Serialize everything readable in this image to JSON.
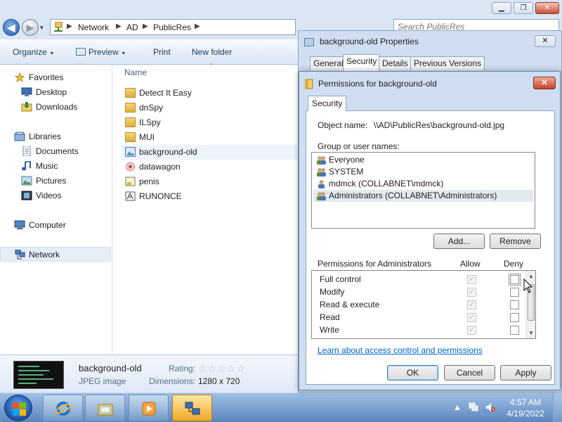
{
  "explorer": {
    "controls": {
      "minimize": "▁",
      "maximize": "❐",
      "close": "✕"
    },
    "nav": {
      "back": "◀",
      "forward": "▶",
      "dropdown": "▾"
    },
    "address": {
      "segments": [
        "Network",
        "AD",
        "PublicRes"
      ],
      "separator": "▶"
    },
    "search": {
      "placeholder": "Search PublicRes"
    },
    "toolbar": {
      "organize": "Organize",
      "preview": "Preview",
      "print": "Print",
      "new_folder": "New folder",
      "caret": "▾"
    },
    "navpane": {
      "favorites": "Favorites",
      "favorites_items": [
        "Desktop",
        "Downloads"
      ],
      "libraries": "Libraries",
      "libraries_items": [
        "Documents",
        "Music",
        "Pictures",
        "Videos"
      ],
      "computer": "Computer",
      "network": "Network"
    },
    "column_header": "Name",
    "files": [
      {
        "name": "Detect It Easy",
        "type": "folder"
      },
      {
        "name": "dnSpy",
        "type": "folder"
      },
      {
        "name": "ILSpy",
        "type": "folder"
      },
      {
        "name": "MUI",
        "type": "folder"
      },
      {
        "name": "background-old",
        "type": "image",
        "selected": true
      },
      {
        "name": "datawagon",
        "type": "app"
      },
      {
        "name": "penis",
        "type": "script"
      },
      {
        "name": "RUNONCE",
        "type": "app"
      }
    ],
    "details": {
      "file_name": "background-old",
      "file_type": "JPEG image",
      "rating_label": "Rating:",
      "stars": "☆☆☆☆☆",
      "dimensions_label": "Dimensions:",
      "dimensions_value": "1280 x 720"
    }
  },
  "properties": {
    "title": "background-old Properties",
    "close": "✕",
    "tabs": [
      "General",
      "Security",
      "Details",
      "Previous Versions"
    ],
    "active_tab": "Security"
  },
  "permissions": {
    "title": "Permissions for background-old",
    "close": "✕",
    "tab": "Security",
    "object_label": "Object name:",
    "object_value": "\\\\AD\\PublicRes\\background-old.jpg",
    "group_label": "Group or user names:",
    "users": [
      "Everyone",
      "SYSTEM",
      "mdmck (COLLABNET\\mdmck)",
      "Administrators (COLLABNET\\Administrators)"
    ],
    "selected_user": "Administrators (COLLABNET\\Administrators)",
    "add_button": "Add...",
    "remove_button": "Remove",
    "perm_header": "Permissions for Administrators",
    "allow_header": "Allow",
    "deny_header": "Deny",
    "perms": [
      {
        "name": "Full control",
        "allow": true,
        "deny": false
      },
      {
        "name": "Modify",
        "allow": true,
        "deny": false
      },
      {
        "name": "Read & execute",
        "allow": true,
        "deny": false
      },
      {
        "name": "Read",
        "allow": true,
        "deny": false
      },
      {
        "name": "Write",
        "allow": true,
        "deny": false
      }
    ],
    "check_mark": "✓",
    "scroll_up": "▲",
    "scroll_down": "▼",
    "link": "Learn about access control and permissions",
    "ok": "OK",
    "cancel": "Cancel",
    "apply": "Apply"
  },
  "taskbar": {
    "time": "4:57 AM",
    "date": "4/19/2022",
    "tray_hidden": "▲"
  }
}
